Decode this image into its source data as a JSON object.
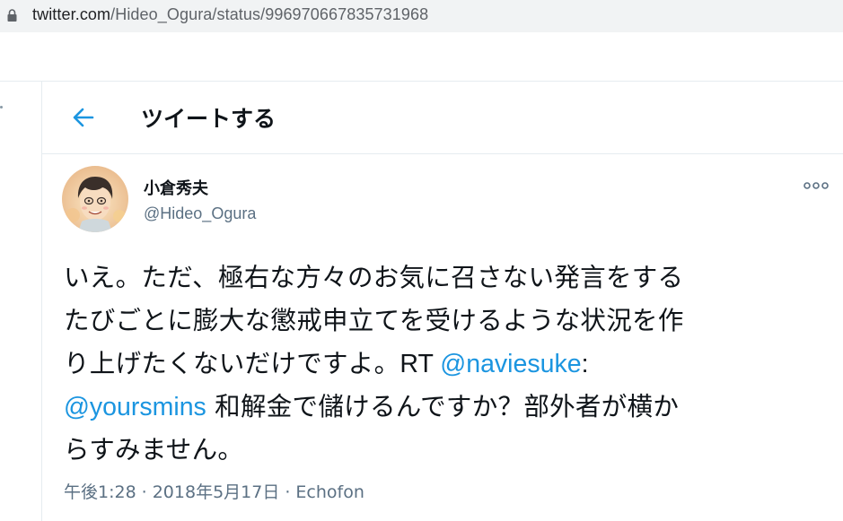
{
  "browser": {
    "url_host": "twitter.com",
    "url_path": "/Hideo_Ogura/status/996970667835731968"
  },
  "header": {
    "title": "ツイートする"
  },
  "tweet": {
    "author_name": "小倉秀夫",
    "author_handle": "@Hideo_Ogura",
    "text_line1": "いえ。ただ、極右な方々のお気に召さない発言をする",
    "text_line2": "たびごとに膨大な懲戒申立てを受けるような状況を作",
    "text_line3_a": "り上げたくないだけですよ。",
    "text_line3_b": "RT ",
    "mention1": "@naviesuke",
    "text_line3_c": ":",
    "mention2": "@yoursmins",
    "text_line4_b": " 和解金で儲けるんですか？部外者が横か",
    "text_line5": "らすみません。",
    "time": "午後1:28",
    "date": "2018年5月17日",
    "source": "Echofon",
    "separator": "·"
  },
  "colors": {
    "accent": "#1b95e0",
    "secondary_text": "#5b7083",
    "border": "#e6ecf0"
  }
}
